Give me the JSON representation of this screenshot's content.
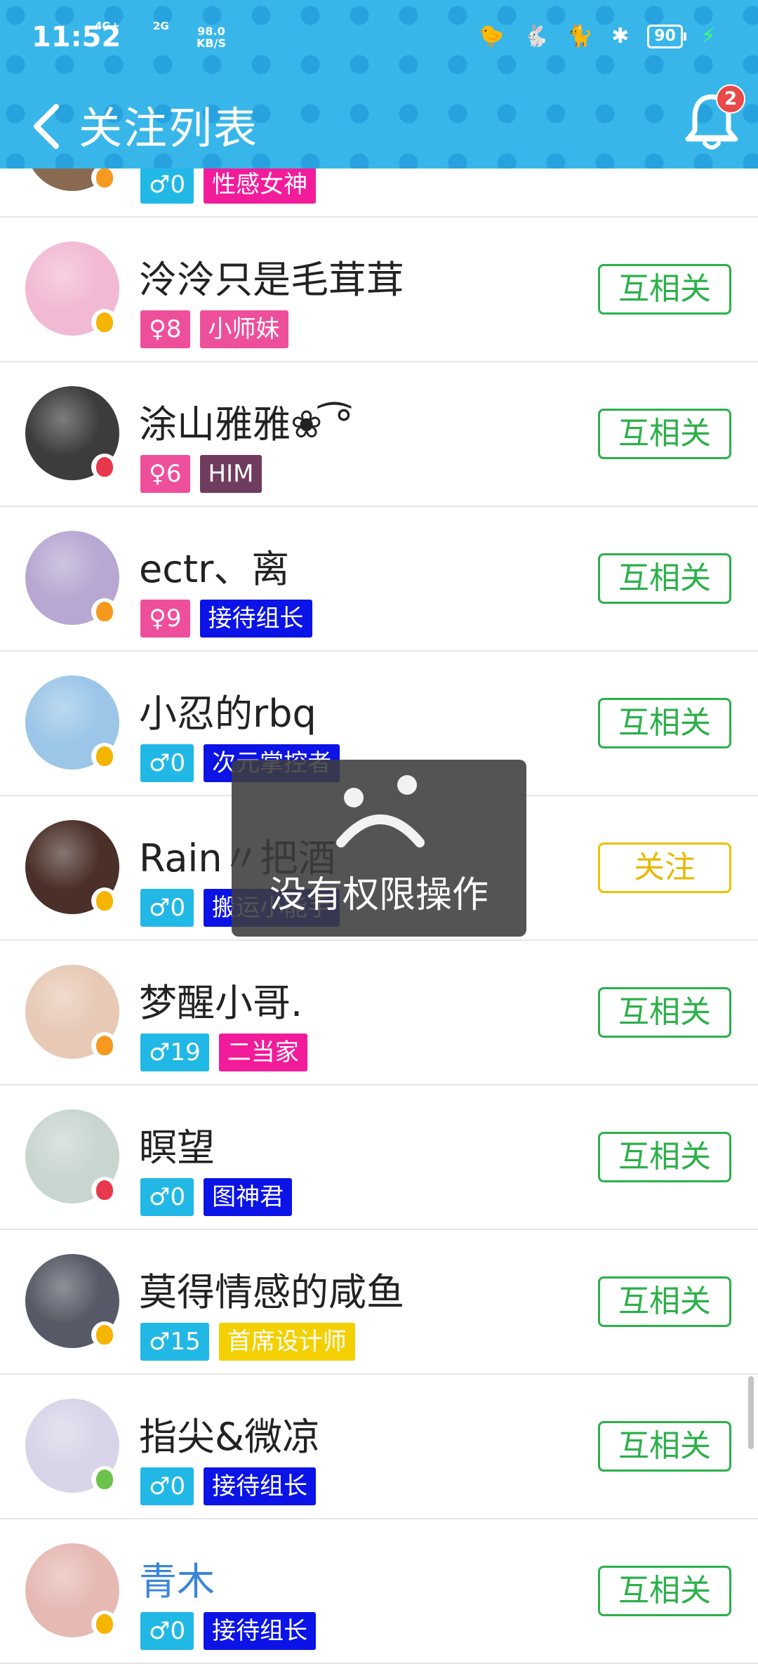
{
  "status": {
    "time": "11:52",
    "net1": "4G+",
    "net2": "2G",
    "speed_value": "98.0",
    "speed_unit": "KB/S",
    "battery": "90"
  },
  "header": {
    "title": "关注列表",
    "notification_count": "2"
  },
  "toast": {
    "message": "没有权限操作"
  },
  "users": [
    {
      "name": "",
      "gender": "♂0",
      "gender_type": "male",
      "title": "性感女神",
      "title_color": "#f21b9a",
      "avatar_color": "#8a6a50",
      "fruit_color": "#f59a1f",
      "button": "",
      "button_style": "green"
    },
    {
      "name": "泠泠只是毛茸茸",
      "gender": "♀8",
      "gender_type": "female",
      "title": "小师妹",
      "title_color": "#ee4f9a",
      "avatar_color": "#f2b9d4",
      "fruit_color": "#f5b400",
      "button": "互相关",
      "button_style": "green"
    },
    {
      "name": "涂山雅雅❀ ͡°",
      "gender": "♀6",
      "gender_type": "female",
      "title": "HIM",
      "title_color": "#6f3c5e",
      "avatar_color": "#3c3c3c",
      "fruit_color": "#e8384d",
      "button": "互相关",
      "button_style": "green"
    },
    {
      "name": "ectr、离",
      "gender": "♀9",
      "gender_type": "female",
      "title": "接待组长",
      "title_color": "#0b13e6",
      "avatar_color": "#b7a7d2",
      "fruit_color": "#f59a1f",
      "button": "互相关",
      "button_style": "green"
    },
    {
      "name": "小忍的rbq",
      "gender": "♂0",
      "gender_type": "male",
      "title": "次元掌控者",
      "title_color": "#0b13e6",
      "avatar_color": "#9bc6e8",
      "fruit_color": "#f5b400",
      "button": "互相关",
      "button_style": "green"
    },
    {
      "name": "Rain〃把酒",
      "gender": "♂0",
      "gender_type": "male",
      "title": "搬运小能手",
      "title_color": "#0b13e6",
      "avatar_color": "#4a3028",
      "fruit_color": "#f5b400",
      "button": "关注",
      "button_style": "yellow"
    },
    {
      "name": "梦醒小哥.",
      "gender": "♂19",
      "gender_type": "male",
      "title": "二当家",
      "title_color": "#f21b9a",
      "avatar_color": "#e7c9b5",
      "fruit_color": "#f59a1f",
      "button": "互相关",
      "button_style": "green"
    },
    {
      "name": "瞑望",
      "gender": "♂0",
      "gender_type": "male",
      "title": "图神君",
      "title_color": "#0b13e6",
      "avatar_color": "#c9d6cf",
      "fruit_color": "#e8384d",
      "button": "互相关",
      "button_style": "green"
    },
    {
      "name": "莫得情感的咸鱼",
      "gender": "♂15",
      "gender_type": "male",
      "title": "首席设计师",
      "title_color": "#f4d000",
      "avatar_color": "#555a66",
      "fruit_color": "#f5b400",
      "button": "互相关",
      "button_style": "green"
    },
    {
      "name": "指尖&微凉",
      "gender": "♂0",
      "gender_type": "male",
      "title": "接待组长",
      "title_color": "#0b13e6",
      "avatar_color": "#d8d4e8",
      "fruit_color": "#6cc24a",
      "button": "互相关",
      "button_style": "green"
    },
    {
      "name": "青木",
      "gender": "♂0",
      "gender_type": "male",
      "title": "接待组长",
      "title_color": "#0b13e6",
      "avatar_color": "#e6b9b3",
      "fruit_color": "#f5b400",
      "button": "互相关",
      "button_style": "green",
      "vip": true
    }
  ]
}
